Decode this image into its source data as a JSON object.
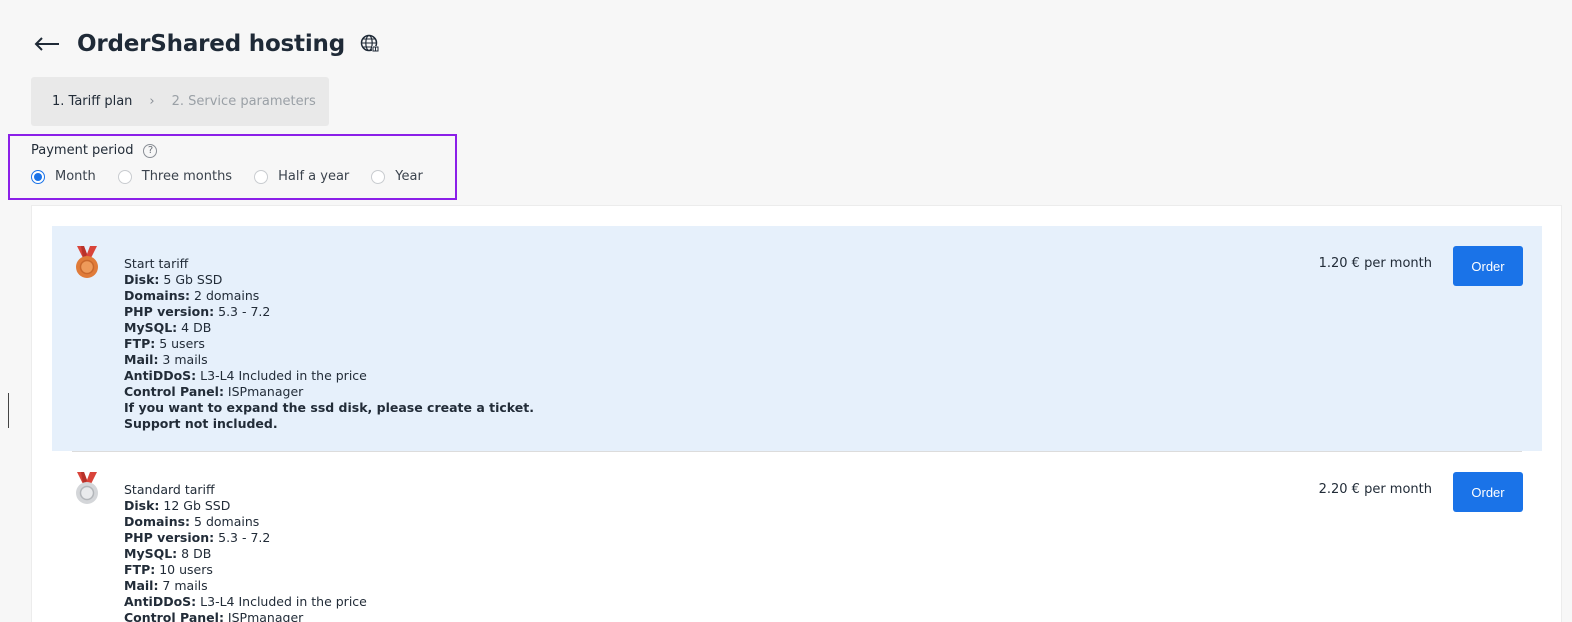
{
  "header": {
    "title": "OrderShared hosting"
  },
  "steps": [
    {
      "label": "1. Tariff plan"
    },
    {
      "label": "2. Service parameters"
    }
  ],
  "payment_period": {
    "label": "Payment period",
    "help": "?",
    "options": [
      {
        "label": "Month",
        "selected": true
      },
      {
        "label": "Three months",
        "selected": false
      },
      {
        "label": "Half a year",
        "selected": false
      },
      {
        "label": "Year",
        "selected": false
      }
    ]
  },
  "tariffs": [
    {
      "name": "Start tariff",
      "medal": "bronze-medal-icon",
      "price": "1.20 € per month",
      "order_label": "Order",
      "specs": [
        {
          "key": "Disk:",
          "value": " 5 Gb SSD"
        },
        {
          "key": "Domains:",
          "value": " 2 domains"
        },
        {
          "key": "PHP version:",
          "value": " 5.3 - 7.2"
        },
        {
          "key": "MySQL:",
          "value": " 4 DB"
        },
        {
          "key": "FTP:",
          "value": " 5 users"
        },
        {
          "key": "Mail:",
          "value": " 3 mails"
        },
        {
          "key": "AntiDDoS:",
          "value": " L3-L4 Included in the price"
        },
        {
          "key": "Control Panel:",
          "value": " ISPmanager"
        }
      ],
      "notes": [
        "If you want to expand the ssd disk, please create a ticket.",
        "Support not included."
      ]
    },
    {
      "name": "Standard tariff",
      "medal": "silver-medal-icon",
      "price": "2.20 € per month",
      "order_label": "Order",
      "specs": [
        {
          "key": "Disk:",
          "value": " 12 Gb SSD"
        },
        {
          "key": "Domains:",
          "value": " 5 domains"
        },
        {
          "key": "PHP version:",
          "value": " 5.3 - 7.2"
        },
        {
          "key": "MySQL:",
          "value": " 8 DB"
        },
        {
          "key": "FTP:",
          "value": " 10 users"
        },
        {
          "key": "Mail:",
          "value": " 7 mails"
        },
        {
          "key": "AntiDDoS:",
          "value": " L3-L4 Included in the price"
        },
        {
          "key": "Control Panel:",
          "value": " ISPmanager"
        }
      ]
    }
  ],
  "colors": {
    "accent": "#1a73e8",
    "highlight_bg": "#e6f0fb",
    "focus_border": "#8b1fe8"
  }
}
